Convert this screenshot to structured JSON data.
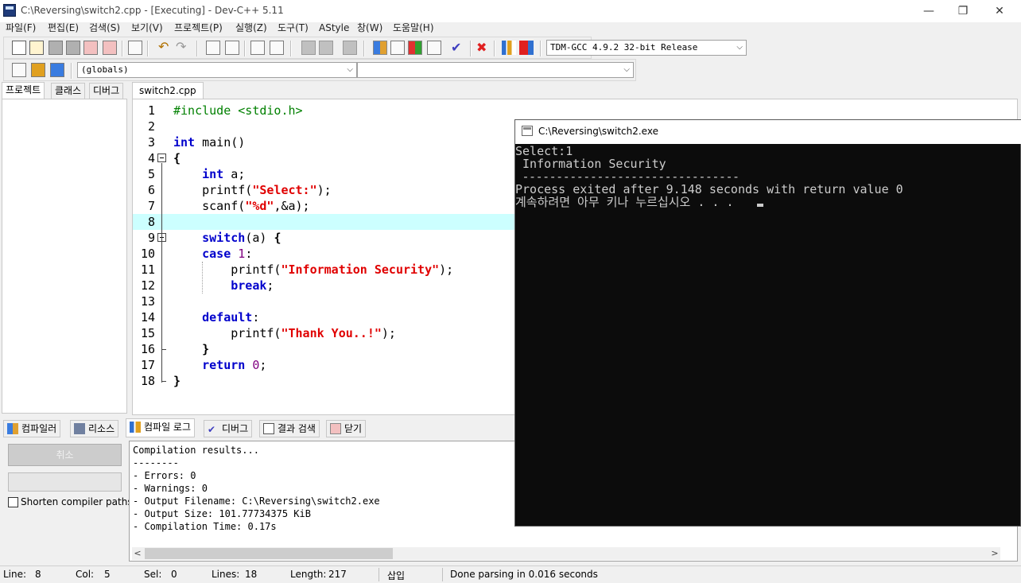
{
  "window": {
    "title": "C:\\Reversing\\switch2.cpp - [Executing] - Dev-C++ 5.11",
    "minimize": "—",
    "restore": "❐",
    "close": "✕"
  },
  "menu": [
    "파일(F)",
    "편집(E)",
    "검색(S)",
    "보기(V)",
    "프로젝트(P)",
    "실행(Z)",
    "도구(T)",
    "AStyle",
    "창(W)",
    "도움말(H)"
  ],
  "toolbar": {
    "compiler_select": "TDM-GCC 4.9.2 32-bit Release",
    "scope_select": "(globals)",
    "function_select": ""
  },
  "left_tabs": [
    "프로젝트",
    "클래스",
    "디버그"
  ],
  "editor": {
    "tab_label": "switch2.cpp",
    "current_line": 8,
    "line_numbers": [
      "1",
      "2",
      "3",
      "4",
      "5",
      "6",
      "7",
      "8",
      "9",
      "10",
      "11",
      "12",
      "13",
      "14",
      "15",
      "16",
      "17",
      "18"
    ]
  },
  "bottom_tabs": [
    "컴파일러",
    "리소스",
    "컴파일 로그",
    "디버그",
    "결과 검색",
    "닫기"
  ],
  "bottom_panel": {
    "cancel_label": "취소",
    "shorten_label": "Shorten compiler paths",
    "log_lines": [
      "Compilation results...",
      "--------",
      "- Errors: 0",
      "- Warnings: 0",
      "- Output Filename: C:\\Reversing\\switch2.exe",
      "- Output Size: 101.77734375 KiB",
      "- Compilation Time: 0.17s"
    ]
  },
  "status": {
    "line_label": "Line:",
    "line_value": "8",
    "col_label": "Col:",
    "col_value": "5",
    "sel_label": "Sel:",
    "sel_value": "0",
    "lines_label": "Lines:",
    "lines_value": "18",
    "length_label": "Length:",
    "length_value": "217",
    "mode": "삽입",
    "message": "Done parsing in 0.016 seconds"
  },
  "console": {
    "title": "C:\\Reversing\\switch2.exe",
    "lines": [
      "Select:1",
      " Information Security",
      " --------------------------------",
      "Process exited after 9.148 seconds with return value 0",
      "계속하려면 아무 키나 누르십시오 . . ."
    ]
  },
  "colors": {
    "keyword": "#0000cc",
    "string": "#e00000",
    "number": "#800080",
    "preprocessor": "#008000",
    "current_line": "#ccffff",
    "console_bg": "#0c0c0c",
    "console_fg": "#cccccc"
  }
}
